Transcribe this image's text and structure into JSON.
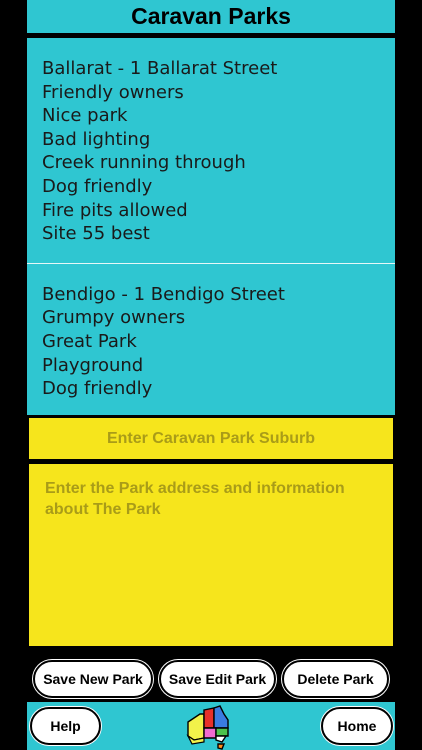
{
  "header": {
    "title": "Caravan Parks"
  },
  "parks": [
    {
      "lines": [
        "Ballarat - 1 Ballarat Street",
        "Friendly owners",
        "Nice park",
        "Bad lighting",
        "Creek running through",
        "Dog friendly",
        "Fire pits allowed",
        "Site 55 best"
      ]
    },
    {
      "lines": [
        "Bendigo - 1 Bendigo Street",
        "Grumpy owners",
        "Great Park",
        "Playground",
        "Dog friendly"
      ]
    }
  ],
  "form": {
    "suburb_placeholder": "Enter Caravan Park Suburb",
    "info_placeholder": "Enter the Park address and information about The Park"
  },
  "actions": {
    "save_new_label": "Save New Park",
    "save_edit_label": "Save Edit Park",
    "delete_label": "Delete Park"
  },
  "nav": {
    "help_label": "Help",
    "home_label": "Home",
    "logo_icon": "australia-map-icon"
  },
  "colors": {
    "header_bg": "#2fc6d1",
    "list_bg": "#2fc6d1",
    "input_bg": "#f6e51c",
    "placeholder_text": "#a99c18",
    "button_bg": "#ffffff"
  }
}
